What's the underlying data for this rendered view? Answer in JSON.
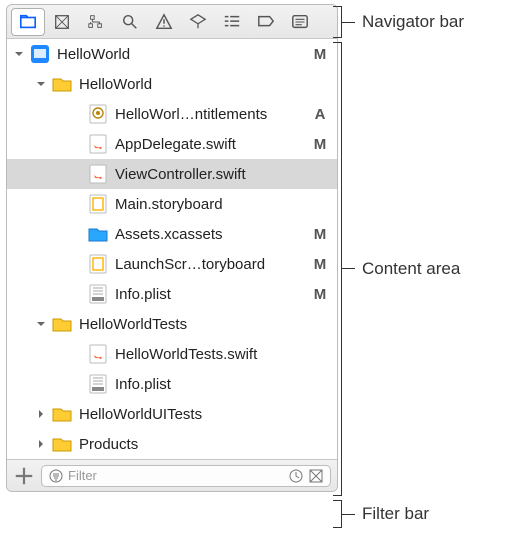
{
  "navigator": {
    "buttons": [
      {
        "name": "folder-icon",
        "active": true
      },
      {
        "name": "source-control-icon"
      },
      {
        "name": "symbol-icon"
      },
      {
        "name": "search-icon"
      },
      {
        "name": "issue-icon"
      },
      {
        "name": "test-icon"
      },
      {
        "name": "debug-icon"
      },
      {
        "name": "breakpoint-icon"
      },
      {
        "name": "report-icon"
      }
    ]
  },
  "tree": [
    {
      "depth": 0,
      "icon": "project",
      "label": "HelloWorld",
      "status": "M",
      "disclosure": "open"
    },
    {
      "depth": 1,
      "icon": "folder",
      "label": "HelloWorld",
      "disclosure": "open"
    },
    {
      "depth": 2,
      "icon": "entitlements",
      "label": "HelloWorl…ntitlements",
      "status": "A"
    },
    {
      "depth": 2,
      "icon": "swift",
      "label": "AppDelegate.swift",
      "status": "M"
    },
    {
      "depth": 2,
      "icon": "swift",
      "label": "ViewController.swift",
      "selected": true
    },
    {
      "depth": 2,
      "icon": "storyboard",
      "label": "Main.storyboard"
    },
    {
      "depth": 2,
      "icon": "assets",
      "label": "Assets.xcassets",
      "status": "M"
    },
    {
      "depth": 2,
      "icon": "storyboard",
      "label": "LaunchScr…toryboard",
      "status": "M"
    },
    {
      "depth": 2,
      "icon": "plist",
      "label": "Info.plist",
      "status": "M"
    },
    {
      "depth": 1,
      "icon": "folder",
      "label": "HelloWorldTests",
      "disclosure": "open"
    },
    {
      "depth": 2,
      "icon": "swift",
      "label": "HelloWorldTests.swift"
    },
    {
      "depth": 2,
      "icon": "plist",
      "label": "Info.plist"
    },
    {
      "depth": 1,
      "icon": "folder",
      "label": "HelloWorldUITests",
      "disclosure": "closed"
    },
    {
      "depth": 1,
      "icon": "folder",
      "label": "Products",
      "disclosure": "closed"
    }
  ],
  "filter": {
    "placeholder": "Filter"
  },
  "callouts": {
    "navbar": "Navigator bar",
    "content": "Content area",
    "filter": "Filter bar"
  }
}
